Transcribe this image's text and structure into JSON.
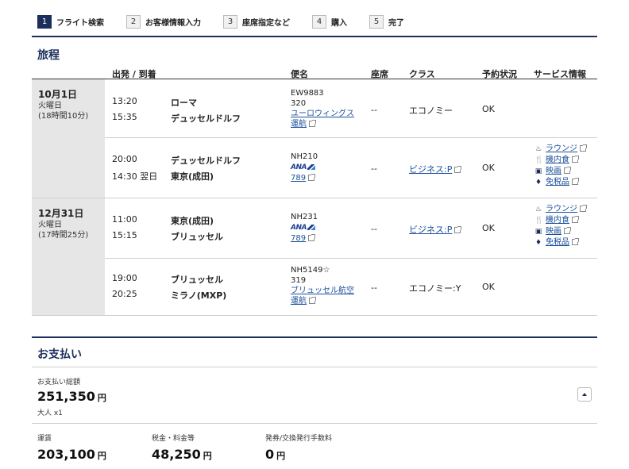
{
  "steps": [
    {
      "num": "1",
      "label": "フライト検索"
    },
    {
      "num": "2",
      "label": "お客様情報入力"
    },
    {
      "num": "3",
      "label": "座席指定など"
    },
    {
      "num": "4",
      "label": "購入"
    },
    {
      "num": "5",
      "label": "完了"
    }
  ],
  "itinerary": {
    "title": "旅程",
    "headers": {
      "depart_arrive": "出発 / 到着",
      "flight": "便名",
      "seat": "座席",
      "class": "クラス",
      "status": "予約状況",
      "services": "サービス情報"
    },
    "days": [
      {
        "date": "10月1日",
        "weekday": "火曜日",
        "duration": "(18時間10分)"
      },
      {
        "date": "12月31日",
        "weekday": "火曜日",
        "duration": "(17時間25分)"
      }
    ],
    "segments": [
      {
        "dep_time": "13:20",
        "dep_city": "ローマ",
        "arr_time": "15:35",
        "arr_city": "デュッセルドルフ",
        "flight_no": "EW9883",
        "aircraft": "320",
        "operator_line1": "ユーロウィングス",
        "operator_line2": "運航",
        "seat": "--",
        "class": "エコノミー",
        "status": "OK"
      },
      {
        "dep_time": "20:00",
        "dep_city": "デュッセルドルフ",
        "arr_time": "14:30 翌日",
        "arr_city": "東京(成田)",
        "flight_no": "NH210",
        "airline_logo": "ANA",
        "aircraft": "789",
        "seat": "--",
        "class": "ビジネス:P",
        "status": "OK",
        "services": [
          "ラウンジ",
          "機内食",
          "映画",
          "免税品"
        ]
      },
      {
        "dep_time": "11:00",
        "dep_city": "東京(成田)",
        "arr_time": "15:15",
        "arr_city": "ブリュッセル",
        "flight_no": "NH231",
        "airline_logo": "ANA",
        "aircraft": "789",
        "seat": "--",
        "class": "ビジネス:P",
        "status": "OK",
        "services": [
          "ラウンジ",
          "機内食",
          "映画",
          "免税品"
        ]
      },
      {
        "dep_time": "19:00",
        "dep_city": "ブリュッセル",
        "arr_time": "20:25",
        "arr_city": "ミラノ(MXP)",
        "flight_no": "NH5149",
        "codeshare_mark": "☆",
        "aircraft": "319",
        "operator_line1": "ブリュッセル航空",
        "operator_line2": "運航",
        "seat": "--",
        "class": "エコノミー:Y",
        "status": "OK"
      }
    ]
  },
  "payment": {
    "title": "お支払い",
    "total_label": "お支払い総額",
    "total_value": "251,350",
    "yen": "円",
    "passengers": "大人 x1",
    "fare_label": "運賃",
    "fare_value": "203,100",
    "tax_label": "税金・料金等",
    "tax_value": "48,250",
    "fee_label": "発券/交換発行手数料",
    "fee_value": "0"
  },
  "colors": {
    "navy": "#1c2f5c",
    "link": "#1a4f9c",
    "date_bg": "#e6e6e6"
  }
}
